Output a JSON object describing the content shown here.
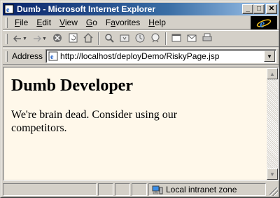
{
  "window": {
    "title": "Dumb - Microsoft Internet Explorer",
    "minimize_glyph": "_",
    "maximize_glyph": "□",
    "close_glyph": "✕"
  },
  "menu": {
    "items": [
      {
        "key": "F",
        "rest": "ile"
      },
      {
        "key": "E",
        "rest": "dit"
      },
      {
        "key": "V",
        "rest": "iew"
      },
      {
        "key": "G",
        "rest": "o"
      },
      {
        "pre": "F",
        "key": "a",
        "rest": "vorites"
      },
      {
        "key": "H",
        "rest": "elp"
      }
    ]
  },
  "toolbar": {
    "icons": [
      "back-icon",
      "forward-icon",
      "stop-icon",
      "refresh-icon",
      "home-icon",
      "search-icon",
      "favorites-icon",
      "history-icon",
      "channels-icon",
      "fullscreen-icon",
      "mail-icon",
      "print-icon"
    ]
  },
  "address": {
    "label": "Address",
    "url": "http://localhost/deployDemo/RiskyPage.jsp"
  },
  "page": {
    "heading": "Dumb Developer",
    "body": "We're brain dead. Consider using our competitors."
  },
  "status": {
    "zone": "Local intranet zone"
  },
  "colors": {
    "page_background": "#fff8ea",
    "chrome": "#d4d0c8",
    "title_start": "#0a246a",
    "title_end": "#a6caf0"
  }
}
